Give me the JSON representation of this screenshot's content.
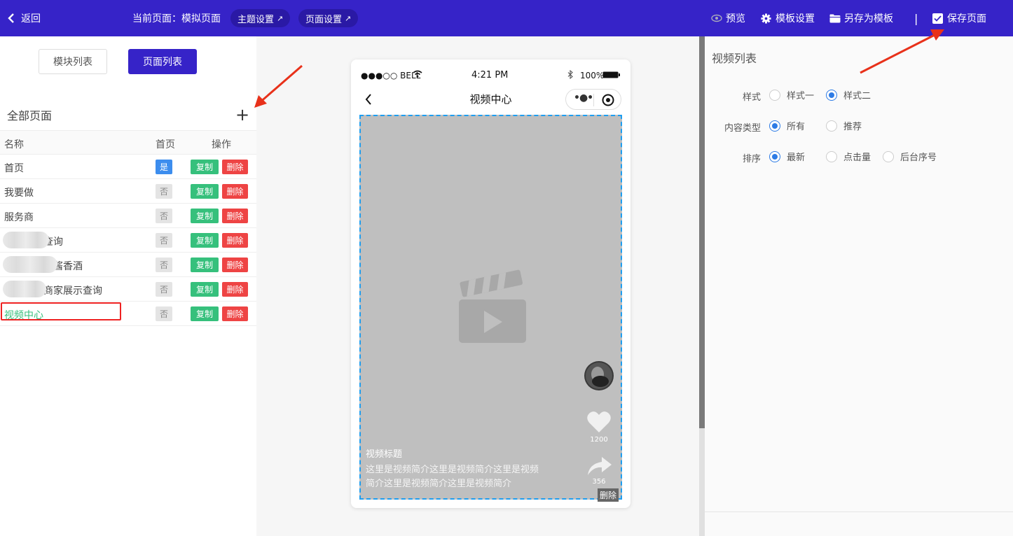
{
  "topbar": {
    "back_label": "返回",
    "current_page_label": "当前页面：模拟页面",
    "theme_settings": "主题设置",
    "page_settings": "页面设置",
    "preview": "预览",
    "template_settings": "模板设置",
    "save_as_template": "另存为模板",
    "separator": "|",
    "save_page": "保存页面"
  },
  "left": {
    "tabs": [
      "模块列表",
      "页面列表"
    ],
    "section_title": "全部页面",
    "add_symbol": "+",
    "columns": {
      "name": "名称",
      "home": "首页",
      "ops": "操作"
    },
    "rows": [
      {
        "name": "首页",
        "home": "是"
      },
      {
        "name": "我要做",
        "home": "否"
      },
      {
        "name": "服务商",
        "home": "否"
      },
      {
        "name": "查询",
        "home": "否"
      },
      {
        "name": "酒酱香酒",
        "home": "否"
      },
      {
        "name": "商家展示查询",
        "home": "否"
      },
      {
        "name": "视频中心",
        "home": "否"
      }
    ],
    "copy_label": "复制",
    "delete_label": "删除"
  },
  "phone": {
    "carrier": "●●●○○ BELL",
    "time": "4:21 PM",
    "battery": "100%",
    "nav_title": "视频中心",
    "video_title": "视频标题",
    "video_desc_line1": "这里是视频简介这里是视频简介这里是视频",
    "video_desc_line2": "简介这里是视频简介这里是视频简介",
    "likes": "1200",
    "shares": "356",
    "delete_label": "删除"
  },
  "right": {
    "title": "视频列表",
    "style_label": "样式",
    "style_options": [
      "样式一",
      "样式二"
    ],
    "style_selected": "样式二",
    "content_type_label": "内容类型",
    "content_type_options": [
      "所有",
      "推荐"
    ],
    "content_type_selected": "所有",
    "sort_label": "排序",
    "sort_options": [
      "最新",
      "点击量",
      "后台序号"
    ],
    "sort_selected": "最新"
  },
  "colors": {
    "topbar": "#3623c8",
    "pill": "#2a19a5",
    "copy": "#36c07c",
    "delete": "#ee4444",
    "radio": "#2d7be5",
    "highlight": "#ee2222",
    "arrow": "#e8311a"
  }
}
